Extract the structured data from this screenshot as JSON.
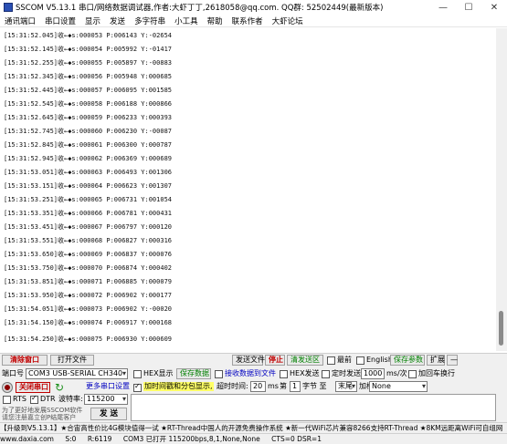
{
  "window": {
    "title": "SSCOM V5.13.1 串口/网络数据调试器,作者:大虾丁丁,2618058@qq.com. QQ群: 52502449(最新版本)",
    "minimize": "—",
    "maximize": "☐",
    "close": "✕"
  },
  "menu": [
    "通讯端口",
    "串口设置",
    "显示",
    "发送",
    "多字符串",
    "小工具",
    "帮助",
    "联系作者",
    "大虾论坛"
  ],
  "log": [
    "[15:31:52.045]收←◆s:000053 P:006143 Y:-02654",
    "[15:31:52.145]收←◆s:000054 P:005992 Y:-01417",
    "[15:31:52.255]收←◆s:000055 P:005897 Y:-00883",
    "[15:31:52.345]收←◆s:000056 P:005948 Y:000685",
    "[15:31:52.445]收←◆s:000057 P:006095 Y:001585",
    "[15:31:52.545]收←◆s:000058 P:006188 Y:000866",
    "[15:31:52.645]收←◆s:000059 P:006233 Y:000393",
    "[15:31:52.745]收←◆s:000060 P:006230 Y:-00087",
    "[15:31:52.845]收←◆s:000061 P:006300 Y:000787",
    "[15:31:52.945]收←◆s:000062 P:006369 Y:000689",
    "[15:31:53.051]收←◆s:000063 P:006493 Y:001306",
    "[15:31:53.151]收←◆s:000064 P:006623 Y:001307",
    "[15:31:53.251]收←◆s:000065 P:006731 Y:001054",
    "[15:31:53.351]收←◆s:000066 P:006781 Y:000431",
    "[15:31:53.451]收←◆s:000067 P:006797 Y:000120",
    "[15:31:53.551]收←◆s:000068 P:006827 Y:000316",
    "[15:31:53.650]收←◆s:000069 P:006837 Y:000076",
    "[15:31:53.750]收←◆s:000070 P:006874 Y:000402",
    "[15:31:53.851]收←◆s:000071 P:006885 Y:000079",
    "[15:31:53.950]收←◆s:000072 P:006902 Y:000177",
    "[15:31:54.051]收←◆s:000073 P:006902 Y:-00020",
    "[15:31:54.150]收←◆s:000074 P:006917 Y:000168",
    "[15:31:54.250]收←◆s:000075 P:006930 Y:000609"
  ],
  "toolbar": {
    "clear_window": "清除窗口",
    "open_file": "打开文件",
    "send_file": "发送文件",
    "stop": "停止",
    "clear_send": "清发送区",
    "topmost": "最前",
    "english": "English",
    "save_params": "保存参数",
    "expand": "扩展",
    "collapse": "—"
  },
  "panel": {
    "port_label": "端口号",
    "port_value": "COM3 USB-SERIAL CH340",
    "hex_display": "HEX显示",
    "save_data": "保存数据",
    "recv_to_file": "接收数据到文件",
    "hex_send": "HEX发送",
    "timed_send": "定时发送:",
    "interval_value": "1000",
    "interval_unit": "ms/次",
    "add_newline": "加回车换行",
    "more_settings": "更多串口设置",
    "close_port": "关闭串口",
    "refresh_icon": "refresh-icon",
    "add_timestamp": "加时间戳和分包显示,",
    "timeout_label": "超时时间:",
    "timeout_value": "20",
    "timeout_unit": "ms",
    "byte_no_label": "第",
    "byte_no_value": "1",
    "byte_unit": "字节 至",
    "end_value": "末尾",
    "checksum_label": "加校验",
    "checksum_value": "None",
    "rts": "RTS",
    "dtr": "DTR",
    "baud_label": "波特率:",
    "baud_value": "115200",
    "promo_line1": "为了更好地发展SSCOM软件",
    "promo_line2": "请您注册嘉立创P结尾客户",
    "send_button": "发 送"
  },
  "ticker": "【升级到V5.13.1】★合宙高性价比4G模块值得一试 ★RT-Thread中国人的开源免费操作系统 ★新一代WiFi芯片兼容8266支持RT-Thread ★8KM远距离WiFi可自组网",
  "status": {
    "website": "www.daxia.com",
    "s": "S:0",
    "r": "R:6119",
    "port_state": "COM3 已打开 115200bps,8,1,None,None",
    "cts": "CTS=0 DSR=1"
  },
  "colors": {
    "red_text": "#c00000",
    "green_text": "#008000",
    "blue_text": "#0000c0"
  }
}
